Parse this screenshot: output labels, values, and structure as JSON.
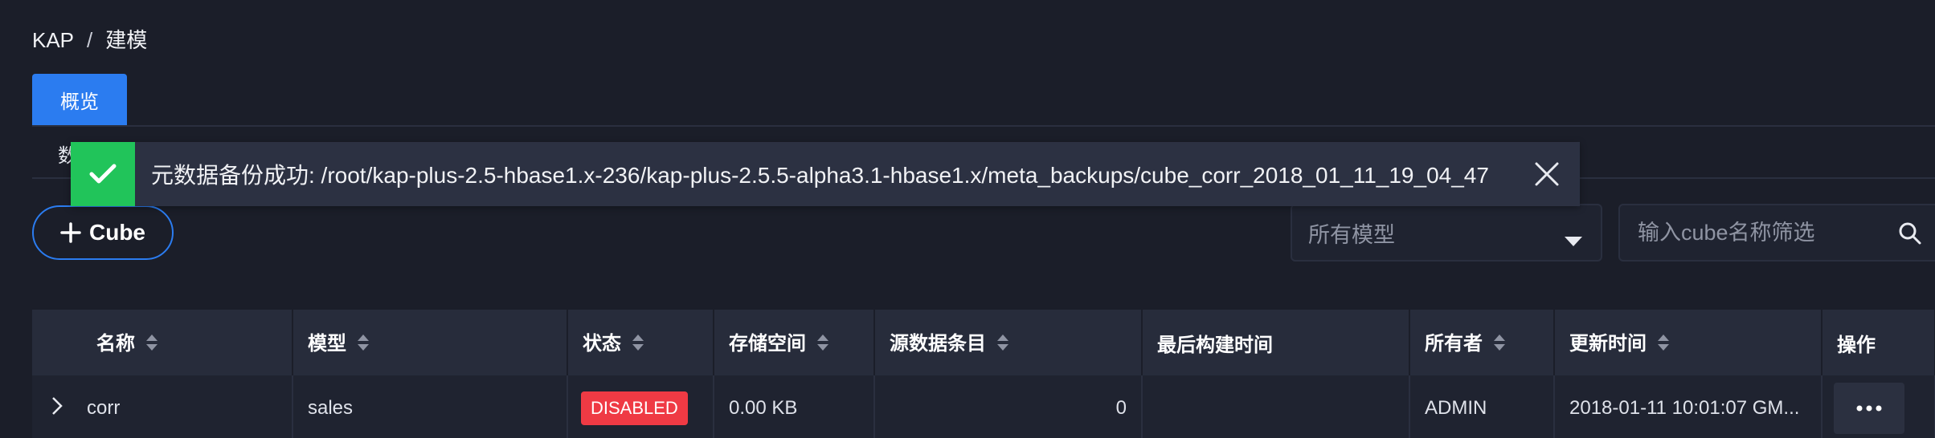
{
  "breadcrumb": {
    "root": "KAP",
    "separator": "/",
    "current": "建模"
  },
  "tabs": {
    "active_label": "概览"
  },
  "subtab": {
    "label": "数"
  },
  "toast": {
    "message": "元数据备份成功: /root/kap-plus-2.5-hbase1.x-236/kap-plus-2.5.5-alpha3.1-hbase1.x/meta_backups/cube_corr_2018_01_11_19_04_47",
    "success_color": "#21c45a"
  },
  "toolbar": {
    "add_cube_label": "Cube",
    "model_select_value": "所有模型",
    "search_placeholder": "输入cube名称筛选"
  },
  "table": {
    "columns": [
      "名称",
      "模型",
      "状态",
      "存储空间",
      "源数据条目",
      "最后构建时间",
      "所有者",
      "更新时间",
      "操作"
    ],
    "rows": [
      {
        "name": "corr",
        "model": "sales",
        "status": "DISABLED",
        "storage": "0.00 KB",
        "source_records": "0",
        "last_build_time": "",
        "owner": "ADMIN",
        "updated": "2018-01-11 10:01:07 GM..."
      }
    ]
  },
  "colors": {
    "accent": "#2b7cf0",
    "danger": "#ef3a44",
    "background": "#1b1e29"
  }
}
